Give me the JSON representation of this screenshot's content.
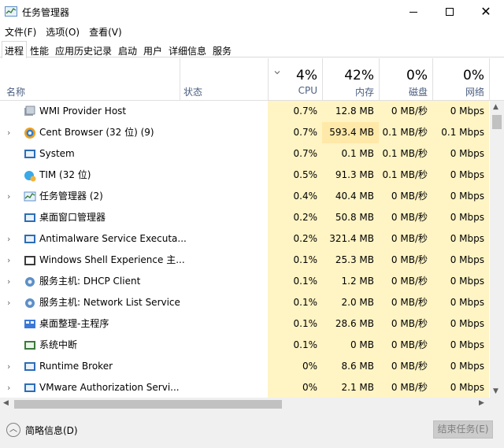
{
  "window": {
    "title": "任务管理器"
  },
  "menu": [
    "文件(F)",
    "选项(O)",
    "查看(V)"
  ],
  "tabs": [
    "进程",
    "性能",
    "应用历史记录",
    "启动",
    "用户",
    "详细信息",
    "服务"
  ],
  "active_tab": "进程",
  "header": {
    "name": "名称",
    "status": "状态",
    "cpu": {
      "pct": "4%",
      "label": "CPU"
    },
    "mem": {
      "pct": "42%",
      "label": "内存"
    },
    "disk": {
      "pct": "0%",
      "label": "磁盘"
    },
    "net": {
      "pct": "0%",
      "label": "网络"
    }
  },
  "processes": [
    {
      "name": "WMI Provider Host",
      "expandable": false,
      "icon": "wmi-provider-icon",
      "cpu": "0.7%",
      "mem": "12.8 MB",
      "disk": "0 MB/秒",
      "net": "0 Mbps",
      "mem_hi": false,
      "disk_hi": false,
      "net_hi": false
    },
    {
      "name": "Cent Browser (32 位) (9)",
      "expandable": true,
      "icon": "cent-browser-icon",
      "cpu": "0.7%",
      "mem": "593.4 MB",
      "disk": "0.1 MB/秒",
      "net": "0.1 Mbps",
      "mem_hi": true,
      "disk_hi": false,
      "net_hi": false
    },
    {
      "name": "System",
      "expandable": false,
      "icon": "system-icon",
      "cpu": "0.7%",
      "mem": "0.1 MB",
      "disk": "0.1 MB/秒",
      "net": "0 Mbps",
      "mem_hi": false,
      "disk_hi": false,
      "net_hi": false
    },
    {
      "name": "TIM (32 位)",
      "expandable": false,
      "icon": "tim-icon",
      "cpu": "0.5%",
      "mem": "91.3 MB",
      "disk": "0.1 MB/秒",
      "net": "0 Mbps",
      "mem_hi": false,
      "disk_hi": false,
      "net_hi": false
    },
    {
      "name": "任务管理器 (2)",
      "expandable": true,
      "icon": "task-manager-icon",
      "cpu": "0.4%",
      "mem": "40.4 MB",
      "disk": "0 MB/秒",
      "net": "0 Mbps",
      "mem_hi": false,
      "disk_hi": false,
      "net_hi": false
    },
    {
      "name": "桌面窗口管理器",
      "expandable": false,
      "icon": "dwm-icon",
      "cpu": "0.2%",
      "mem": "50.8 MB",
      "disk": "0 MB/秒",
      "net": "0 Mbps",
      "mem_hi": false,
      "disk_hi": false,
      "net_hi": false
    },
    {
      "name": "Antimalware Service Executa...",
      "expandable": true,
      "icon": "antimalware-icon",
      "cpu": "0.2%",
      "mem": "321.4 MB",
      "disk": "0 MB/秒",
      "net": "0 Mbps",
      "mem_hi": false,
      "disk_hi": false,
      "net_hi": false
    },
    {
      "name": "Windows Shell Experience 主...",
      "expandable": true,
      "icon": "shell-experience-icon",
      "cpu": "0.1%",
      "mem": "25.3 MB",
      "disk": "0 MB/秒",
      "net": "0 Mbps",
      "mem_hi": false,
      "disk_hi": false,
      "net_hi": false
    },
    {
      "name": "服务主机: DHCP Client",
      "expandable": true,
      "icon": "service-host-icon",
      "cpu": "0.1%",
      "mem": "1.2 MB",
      "disk": "0 MB/秒",
      "net": "0 Mbps",
      "mem_hi": false,
      "disk_hi": false,
      "net_hi": false
    },
    {
      "name": "服务主机: Network List Service",
      "expandable": true,
      "icon": "service-host-icon",
      "cpu": "0.1%",
      "mem": "2.0 MB",
      "disk": "0 MB/秒",
      "net": "0 Mbps",
      "mem_hi": false,
      "disk_hi": false,
      "net_hi": false
    },
    {
      "name": "桌面整理-主程序",
      "expandable": false,
      "icon": "desktop-organizer-icon",
      "cpu": "0.1%",
      "mem": "28.6 MB",
      "disk": "0 MB/秒",
      "net": "0 Mbps",
      "mem_hi": false,
      "disk_hi": false,
      "net_hi": false
    },
    {
      "name": "系统中断",
      "expandable": false,
      "icon": "system-interrupts-icon",
      "cpu": "0.1%",
      "mem": "0 MB",
      "disk": "0 MB/秒",
      "net": "0 Mbps",
      "mem_hi": false,
      "disk_hi": false,
      "net_hi": false
    },
    {
      "name": "Runtime Broker",
      "expandable": true,
      "icon": "runtime-broker-icon",
      "cpu": "0%",
      "mem": "8.6 MB",
      "disk": "0 MB/秒",
      "net": "0 Mbps",
      "mem_hi": false,
      "disk_hi": false,
      "net_hi": false
    },
    {
      "name": "VMware Authorization Servi...",
      "expandable": true,
      "icon": "vmware-icon",
      "cpu": "0%",
      "mem": "2.1 MB",
      "disk": "0 MB/秒",
      "net": "0 Mbps",
      "mem_hi": false,
      "disk_hi": false,
      "net_hi": false
    }
  ],
  "footer": {
    "fewer_details": "简略信息(D)",
    "end_task": "结束任务(E)"
  },
  "colors": {
    "light_shade": "#fff4c4",
    "medium_shade": "#ffe9a8",
    "header_label": "#4d6082"
  }
}
